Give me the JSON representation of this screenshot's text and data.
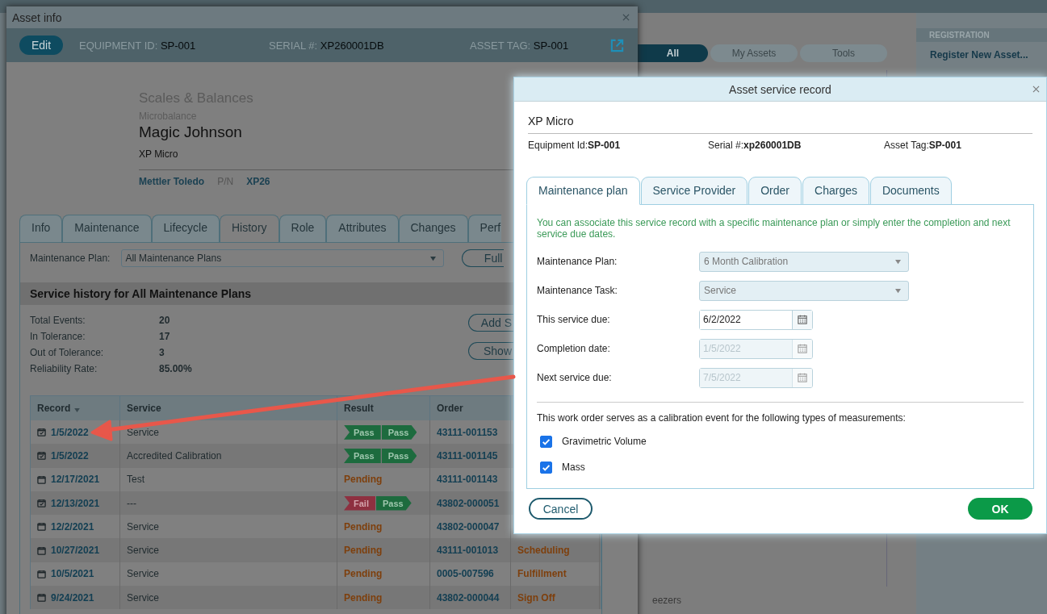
{
  "background": {
    "segments": [
      {
        "label": "All",
        "selected": true
      },
      {
        "label": "My Assets",
        "selected": false
      },
      {
        "label": "Tools",
        "selected": false
      }
    ],
    "sidebar": {
      "heading": "REGISTRATION",
      "items": [
        "Register New Asset..."
      ]
    },
    "fragment": "eezers"
  },
  "asset_window": {
    "title": "Asset info",
    "edit_button": "Edit",
    "fields": [
      {
        "label": "EQUIPMENT ID:",
        "value": "SP-001"
      },
      {
        "label": "SERIAL #:",
        "value": "XP260001DB"
      },
      {
        "label": "ASSET TAG:",
        "value": "SP-001"
      }
    ],
    "category": "Scales & Balances",
    "subcategory": "Microbalance",
    "name": "Magic Johnson",
    "model": "XP Micro",
    "manufacturer": "Mettler Toledo",
    "pn_label": "P/N",
    "pn": "XP26",
    "tabs": [
      {
        "label": "Info",
        "selected": false
      },
      {
        "label": "Maintenance",
        "selected": false
      },
      {
        "label": "Lifecycle",
        "selected": false
      },
      {
        "label": "History",
        "selected": true
      },
      {
        "label": "Role",
        "selected": false
      },
      {
        "label": "Attributes",
        "selected": false
      },
      {
        "label": "Changes",
        "selected": false
      },
      {
        "label": "Perf",
        "selected": false
      }
    ],
    "plan_label": "Maintenance Plan:",
    "plan_value": "All Maintenance Plans",
    "full_button": "Full",
    "section_title": "Service history for All Maintenance Plans",
    "stats": [
      {
        "label": "Total Events:",
        "value": "20"
      },
      {
        "label": "In Tolerance:",
        "value": "17"
      },
      {
        "label": "Out of Tolerance:",
        "value": "3"
      },
      {
        "label": "Reliability Rate:",
        "value": "85.00%"
      }
    ],
    "side_buttons": [
      "Add S",
      "Show"
    ],
    "table": {
      "columns": [
        "Record",
        "Service",
        "Result",
        "Order"
      ],
      "rows": [
        {
          "record": "1/5/2022",
          "completed": true,
          "service": "Service",
          "result": {
            "kind": "badges",
            "badges": [
              {
                "label": "Pass",
                "kind": "pass"
              },
              {
                "label": "Pass",
                "kind": "pass"
              }
            ]
          },
          "order": "43111-001153"
        },
        {
          "record": "1/5/2022",
          "completed": true,
          "service": "Accredited Calibration",
          "result": {
            "kind": "badges",
            "badges": [
              {
                "label": "Pass",
                "kind": "pass"
              },
              {
                "label": "Pass",
                "kind": "pass"
              }
            ]
          },
          "order": "43111-001145"
        },
        {
          "record": "12/17/2021",
          "completed": false,
          "service": "Test",
          "result": {
            "kind": "pending",
            "text": "Pending"
          },
          "order": "43111-001143"
        },
        {
          "record": "12/13/2021",
          "completed": true,
          "service": "---",
          "result": {
            "kind": "badges",
            "badges": [
              {
                "label": "Fail",
                "kind": "fail"
              },
              {
                "label": "Pass",
                "kind": "pass"
              }
            ]
          },
          "order": "43802-000051"
        },
        {
          "record": "12/2/2021",
          "completed": false,
          "service": "Service",
          "result": {
            "kind": "pending",
            "text": "Pending"
          },
          "order": "43802-000047"
        },
        {
          "record": "10/27/2021",
          "completed": false,
          "service": "Service",
          "result": {
            "kind": "pending",
            "text": "Pending"
          },
          "order": "43111-001013",
          "status": "Scheduling"
        },
        {
          "record": "10/5/2021",
          "completed": false,
          "service": "Service",
          "result": {
            "kind": "pending",
            "text": "Pending"
          },
          "order": "0005-007596",
          "status": "Fulfillment"
        },
        {
          "record": "9/24/2021",
          "completed": false,
          "service": "Service",
          "result": {
            "kind": "pending",
            "text": "Pending"
          },
          "order": "43802-000044",
          "status": "Sign Off"
        }
      ]
    }
  },
  "dialog": {
    "title": "Asset service record",
    "asset_name": "XP Micro",
    "fields": [
      {
        "label": "Equipment Id:",
        "value": "SP-001"
      },
      {
        "label": "Serial #:",
        "value": "xp260001DB"
      },
      {
        "label": "Asset Tag:",
        "value": "SP-001"
      }
    ],
    "tabs": [
      {
        "label": "Maintenance plan",
        "selected": true
      },
      {
        "label": "Service Provider",
        "selected": false
      },
      {
        "label": "Order",
        "selected": false
      },
      {
        "label": "Charges",
        "selected": false
      },
      {
        "label": "Documents",
        "selected": false
      }
    ],
    "note": "You can associate this service record with a specific maintenance plan or simply enter the completion and next service due dates.",
    "form": [
      {
        "kind": "select",
        "label": "Maintenance Plan:",
        "value": "6 Month Calibration",
        "disabled": true
      },
      {
        "kind": "select",
        "label": "Maintenance Task:",
        "value": "Service",
        "disabled": true
      },
      {
        "kind": "date",
        "label": "This service due:",
        "value": "6/2/2022",
        "disabled": false
      },
      {
        "kind": "date",
        "label": "Completion date:",
        "value": "1/5/2022",
        "disabled": true
      },
      {
        "kind": "date",
        "label": "Next service due:",
        "value": "7/5/2022",
        "disabled": true
      }
    ],
    "measurements_note": "This work order serves as a calibration event for the following types of measurements:",
    "measurements": [
      {
        "label": "Gravimetric Volume",
        "checked": true
      },
      {
        "label": "Mass",
        "checked": true
      }
    ],
    "cancel_button": "Cancel",
    "ok_button": "OK"
  }
}
